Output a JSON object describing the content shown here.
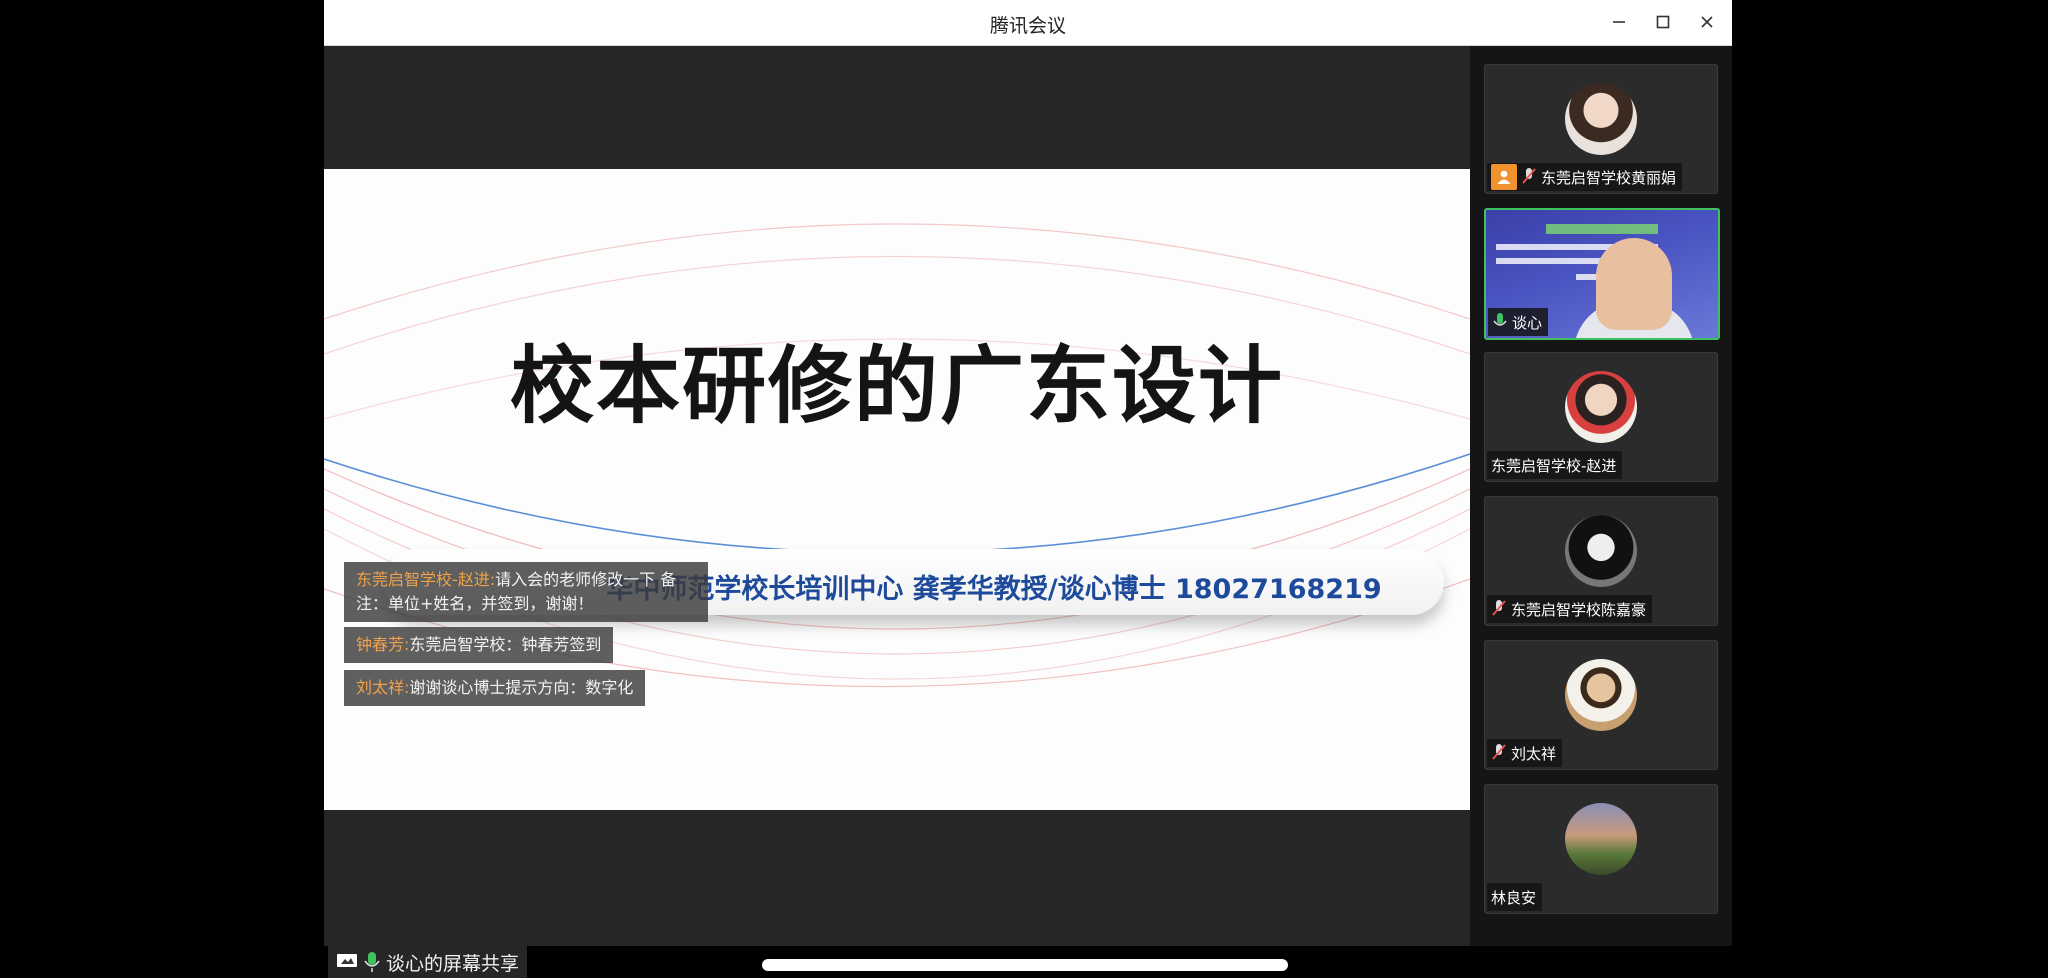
{
  "window": {
    "title": "腾讯会议"
  },
  "slide": {
    "title": "校本研修的广东设计",
    "banner": "华中师范学校长培训中心  龚孝华教授/谈心博士  18027168219"
  },
  "chat": [
    {
      "name": "东莞启智学校-赵进:",
      "text": "请入会的老师修改一下 备注：单位+姓名，并签到，谢谢！"
    },
    {
      "name": "钟春芳:",
      "text": "东莞启智学校：钟春芳签到"
    },
    {
      "name": "刘太祥:",
      "text": "谢谢谈心博士提示方向：数字化"
    }
  ],
  "share_status": "谈心的屏幕共享",
  "participants": [
    {
      "name": "东莞启智学校黄丽娟",
      "host": true,
      "mic": "muted",
      "avatar_color": "#c9a08a",
      "active": false,
      "video": false
    },
    {
      "name": "谈心",
      "host": false,
      "mic": "on",
      "avatar_color": "#e8c0a0",
      "active": true,
      "video": true
    },
    {
      "name": "东莞启智学校-赵进",
      "host": false,
      "mic": "none",
      "avatar_color": "#d8b896",
      "active": false,
      "video": false
    },
    {
      "name": "东莞启智学校陈嘉豪",
      "host": false,
      "mic": "muted",
      "avatar_color": "#444444",
      "active": false,
      "video": false
    },
    {
      "name": "刘太祥",
      "host": false,
      "mic": "muted",
      "avatar_color": "#b98a5a",
      "active": false,
      "video": false
    },
    {
      "name": "林良安",
      "host": false,
      "mic": "none",
      "avatar_color": "#7a6a8a",
      "active": false,
      "video": false
    }
  ],
  "colors": {
    "accent_green": "#3ec25f",
    "host_orange": "#f0922e",
    "banner_blue": "#1d4a9a",
    "chat_name": "#f0a24a"
  }
}
